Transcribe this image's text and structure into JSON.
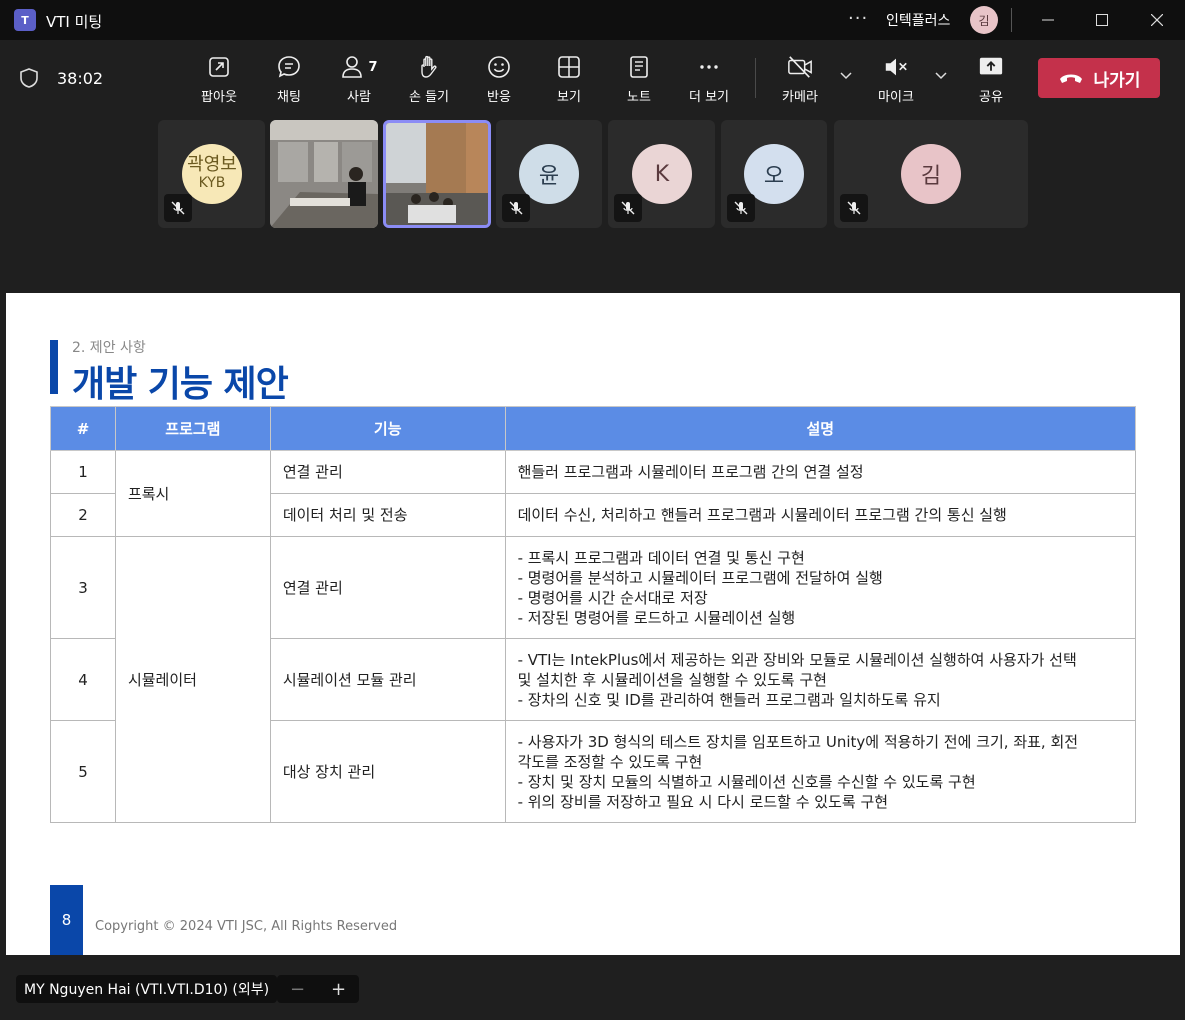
{
  "window": {
    "title": "VTI 미팅",
    "app_icon": "teams-icon",
    "org_name": "인텍플러스",
    "user_initial": "김",
    "more": "···"
  },
  "toolbar": {
    "timer": "38:02",
    "tools": [
      {
        "label": "팝아웃",
        "icon": "popout-icon"
      },
      {
        "label": "채팅",
        "icon": "chat-icon"
      },
      {
        "label": "사람",
        "icon": "people-icon",
        "count": "7"
      },
      {
        "label": "손 들기",
        "icon": "raise-hand-icon"
      },
      {
        "label": "반응",
        "icon": "reaction-icon"
      },
      {
        "label": "보기",
        "icon": "view-icon"
      },
      {
        "label": "노트",
        "icon": "notes-icon"
      },
      {
        "label": "더 보기",
        "icon": "more-icon"
      }
    ],
    "camera": "카메라",
    "mic": "마이크",
    "share": "공유",
    "leave": "나가기"
  },
  "participants": [
    {
      "name": "곽영보",
      "sub": "KYB",
      "type": "avatar",
      "color": "#f7e8b7"
    },
    {
      "type": "video"
    },
    {
      "type": "video",
      "active": true
    },
    {
      "initial": "윤",
      "type": "avatar",
      "color": "#cfdde8"
    },
    {
      "initial": "K",
      "type": "avatar",
      "color": "#ead5d5"
    },
    {
      "initial": "오",
      "type": "avatar",
      "color": "#d3dfee"
    },
    {
      "initial": "김",
      "type": "avatar",
      "color": "#e8c4c8"
    }
  ],
  "slide": {
    "subtitle": "2. 제안 사항",
    "title": "개발 기능 제안",
    "headers": [
      "#",
      "프로그램",
      "기능",
      "설명"
    ],
    "rows": [
      {
        "num": "1",
        "program": "프록시",
        "feature": "연결 관리",
        "desc": [
          "핸들러 프로그램과 시뮬레이터 프로그램 간의 연결 설정"
        ]
      },
      {
        "num": "2",
        "feature": "데이터 처리 및 전송",
        "desc": [
          "데이터 수신, 처리하고 핸들러 프로그램과 시뮬레이터 프로그램 간의 통신 실행"
        ]
      },
      {
        "num": "3",
        "program": "시뮬레이터",
        "feature": "연결 관리",
        "desc": [
          "- 프록시 프로그램과 데이터 연결 및 통신 구현",
          "- 명령어를 분석하고 시뮬레이터 프로그램에 전달하여 실행",
          "- 명령어를 시간 순서대로 저장",
          "- 저장된 명령어를 로드하고 시뮬레이션 실행"
        ]
      },
      {
        "num": "4",
        "feature": "시뮬레이션 모듈 관리",
        "desc": [
          "- VTI는 IntekPlus에서 제공하는 외관 장비와 모듈로 시뮬레이션 실행하여 사용자가 선택",
          "및 설치한 후 시뮬레이션을 실행할 수 있도록 구현",
          "- 장차의 신호 및 ID를 관리하여 핸들러 프로그램과 일치하도록 유지"
        ]
      },
      {
        "num": "5",
        "feature": "대상 장치 관리",
        "desc": [
          "- 사용자가 3D 형식의 테스트 장치를 임포트하고 Unity에 적용하기 전에 크기, 좌표, 회전",
          "각도를 조정할 수 있도록 구현",
          "- 장치 및 장치 모듈의 식별하고 시뮬레이션 신호를 수신할 수 있도록 구현",
          "- 위의 장비를 저장하고 필요 시 다시 로드할 수 있도록 구현"
        ]
      }
    ],
    "page_number": "8",
    "copyright": "Copyright © 2024 VTI JSC, All Rights Reserved"
  },
  "bottom": {
    "presenter": "MY Nguyen Hai (VTI.VTI.D10) (외부)",
    "zoom_out": "−",
    "zoom_in": "+"
  }
}
